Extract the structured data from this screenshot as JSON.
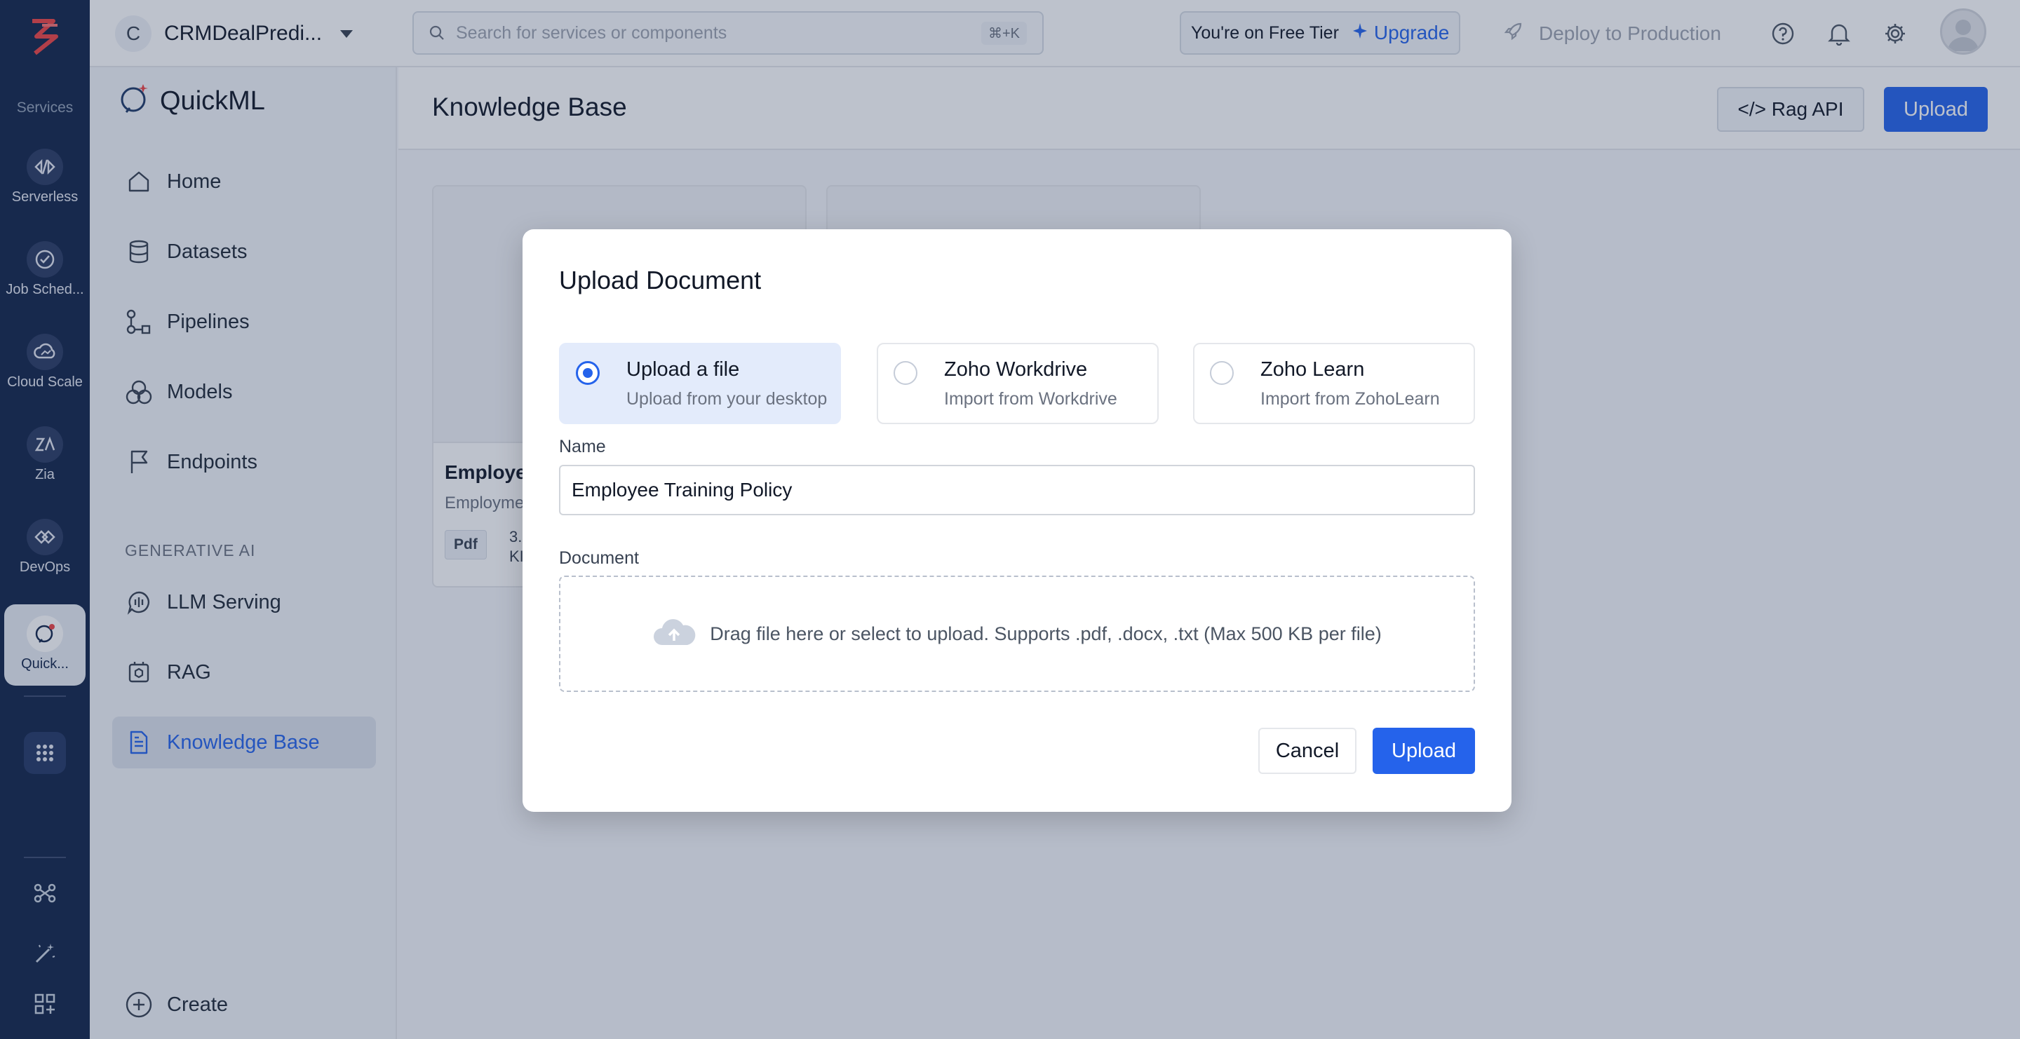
{
  "rail": {
    "section_label": "Services",
    "items": [
      {
        "label": "Serverless",
        "icon": "serverless-icon"
      },
      {
        "label": "Job Sched...",
        "icon": "job-scheduler-icon"
      },
      {
        "label": "Cloud Scale",
        "icon": "cloud-scale-icon"
      },
      {
        "label": "Zia",
        "icon": "zia-icon"
      },
      {
        "label": "DevOps",
        "icon": "devops-icon"
      },
      {
        "label": "Quick...",
        "icon": "quickml-icon"
      }
    ]
  },
  "topbar": {
    "project_initial": "C",
    "project_name": "CRMDealPredi...",
    "search_placeholder": "Search for services or components",
    "search_shortcut": "⌘+K",
    "tier_text": "You're on Free Tier",
    "upgrade_label": "Upgrade",
    "deploy_label": "Deploy to Production"
  },
  "sidenav": {
    "brand": "QuickML",
    "items": [
      {
        "label": "Home"
      },
      {
        "label": "Datasets"
      },
      {
        "label": "Pipelines"
      },
      {
        "label": "Models"
      },
      {
        "label": "Endpoints"
      }
    ],
    "section_title": "GENERATIVE AI",
    "genai_items": [
      {
        "label": "LLM Serving"
      },
      {
        "label": "RAG"
      },
      {
        "label": "Knowledge Base"
      }
    ],
    "create_label": "Create"
  },
  "main": {
    "title": "Knowledge Base",
    "rag_api_label": "</> Rag API",
    "upload_label": "Upload",
    "card": {
      "title": "Employe",
      "subtitle": "Employme",
      "type_tag": "Pdf",
      "size_partial": "3.\nKI"
    }
  },
  "modal": {
    "title": "Upload Document",
    "options": [
      {
        "title": "Upload a file",
        "subtitle": "Upload from your desktop",
        "selected": true
      },
      {
        "title": "Zoho Workdrive",
        "subtitle": "Import from Workdrive",
        "selected": false
      },
      {
        "title": "Zoho Learn",
        "subtitle": "Import from ZohoLearn",
        "selected": false
      }
    ],
    "name_label": "Name",
    "name_value": "Employee Training Policy",
    "document_label": "Document",
    "dropzone_text": "Drag file here or select to upload. Supports .pdf, .docx, .txt (Max 500 KB per file)",
    "cancel_label": "Cancel",
    "upload_label": "Upload"
  },
  "colors": {
    "rail_bg": "#12244a",
    "accent": "#2563eb",
    "selected_option_bg": "#e3ebfb"
  }
}
